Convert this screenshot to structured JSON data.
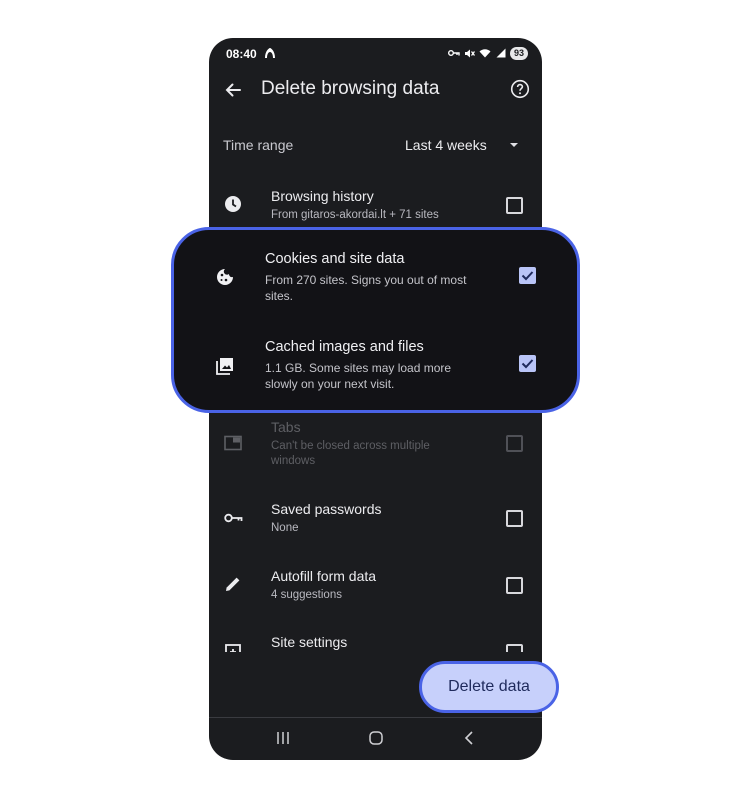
{
  "status_bar": {
    "time": "08:40",
    "battery": "93"
  },
  "header": {
    "title": "Delete browsing data"
  },
  "time_range": {
    "label": "Time range",
    "value": "Last 4 weeks"
  },
  "items": [
    {
      "title": "Browsing history",
      "subtitle": "From gitaros-akordai.lt + 71 sites",
      "checked": false,
      "icon": "clock-icon"
    },
    {
      "title": "Cookies and site data",
      "subtitle": "From 270 sites. Signs you out of most sites.",
      "checked": true,
      "icon": "cookie-icon"
    },
    {
      "title": "Cached images and files",
      "subtitle": "1.1 GB. Some sites may load more slowly on your next visit.",
      "checked": true,
      "icon": "image-icon"
    },
    {
      "title": "Tabs",
      "subtitle": "Can't be closed across multiple windows",
      "checked": false,
      "disabled": true,
      "icon": "tab-icon"
    },
    {
      "title": "Saved passwords",
      "subtitle": "None",
      "checked": false,
      "icon": "key-icon"
    },
    {
      "title": "Autofill form data",
      "subtitle": "4 suggestions",
      "checked": false,
      "icon": "pencil-icon"
    },
    {
      "title": "Site settings",
      "subtitle": "",
      "checked": false,
      "icon": "settings-icon"
    }
  ],
  "action": {
    "delete_label": "Delete data"
  },
  "colors": {
    "accent": "#4a63e6",
    "button_bg": "#c7d0fb",
    "checkbox_checked": "#b9c4f7",
    "surface": "#1b1c1f"
  }
}
